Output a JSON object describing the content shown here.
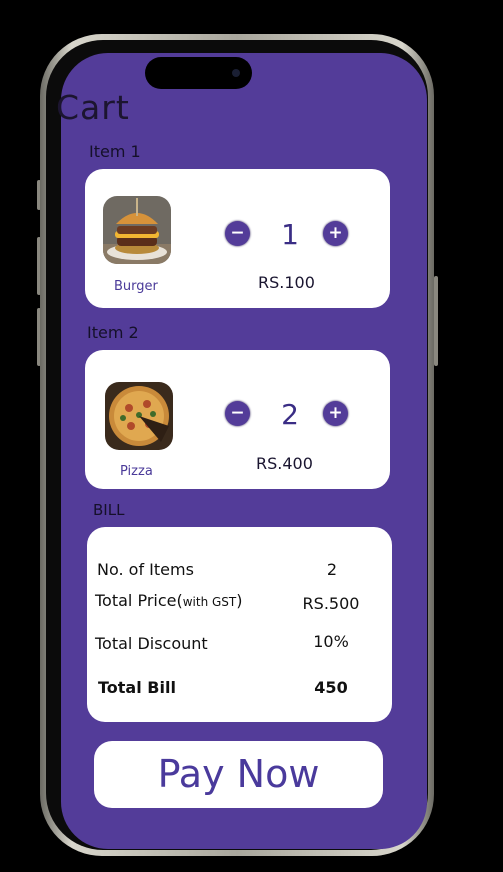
{
  "page": {
    "title": "Cart"
  },
  "items": [
    {
      "section_label": "Item 1",
      "name": "Burger",
      "quantity": "1",
      "price": "RS.100",
      "image": "burger-photo"
    },
    {
      "section_label": "Item 2",
      "name": "Pizza",
      "quantity": "2",
      "price": "RS.400",
      "image": "pizza-photo"
    }
  ],
  "controls": {
    "minus": "−",
    "plus": "+"
  },
  "bill": {
    "section_label": "BILL",
    "items_label": "No. of Items",
    "items_value": "2",
    "price_label": "Total Price",
    "price_note_open": "(",
    "price_note": "with GST",
    "price_note_close": ")",
    "price_value": "RS.500",
    "discount_label": "Total Discount",
    "discount_value": "10%",
    "total_label": "Total Bill",
    "total_value": "450"
  },
  "pay_button": {
    "label": "Pay Now"
  },
  "colors": {
    "accent": "#533c99",
    "card": "#ffffff",
    "text_dark": "#15102a"
  }
}
